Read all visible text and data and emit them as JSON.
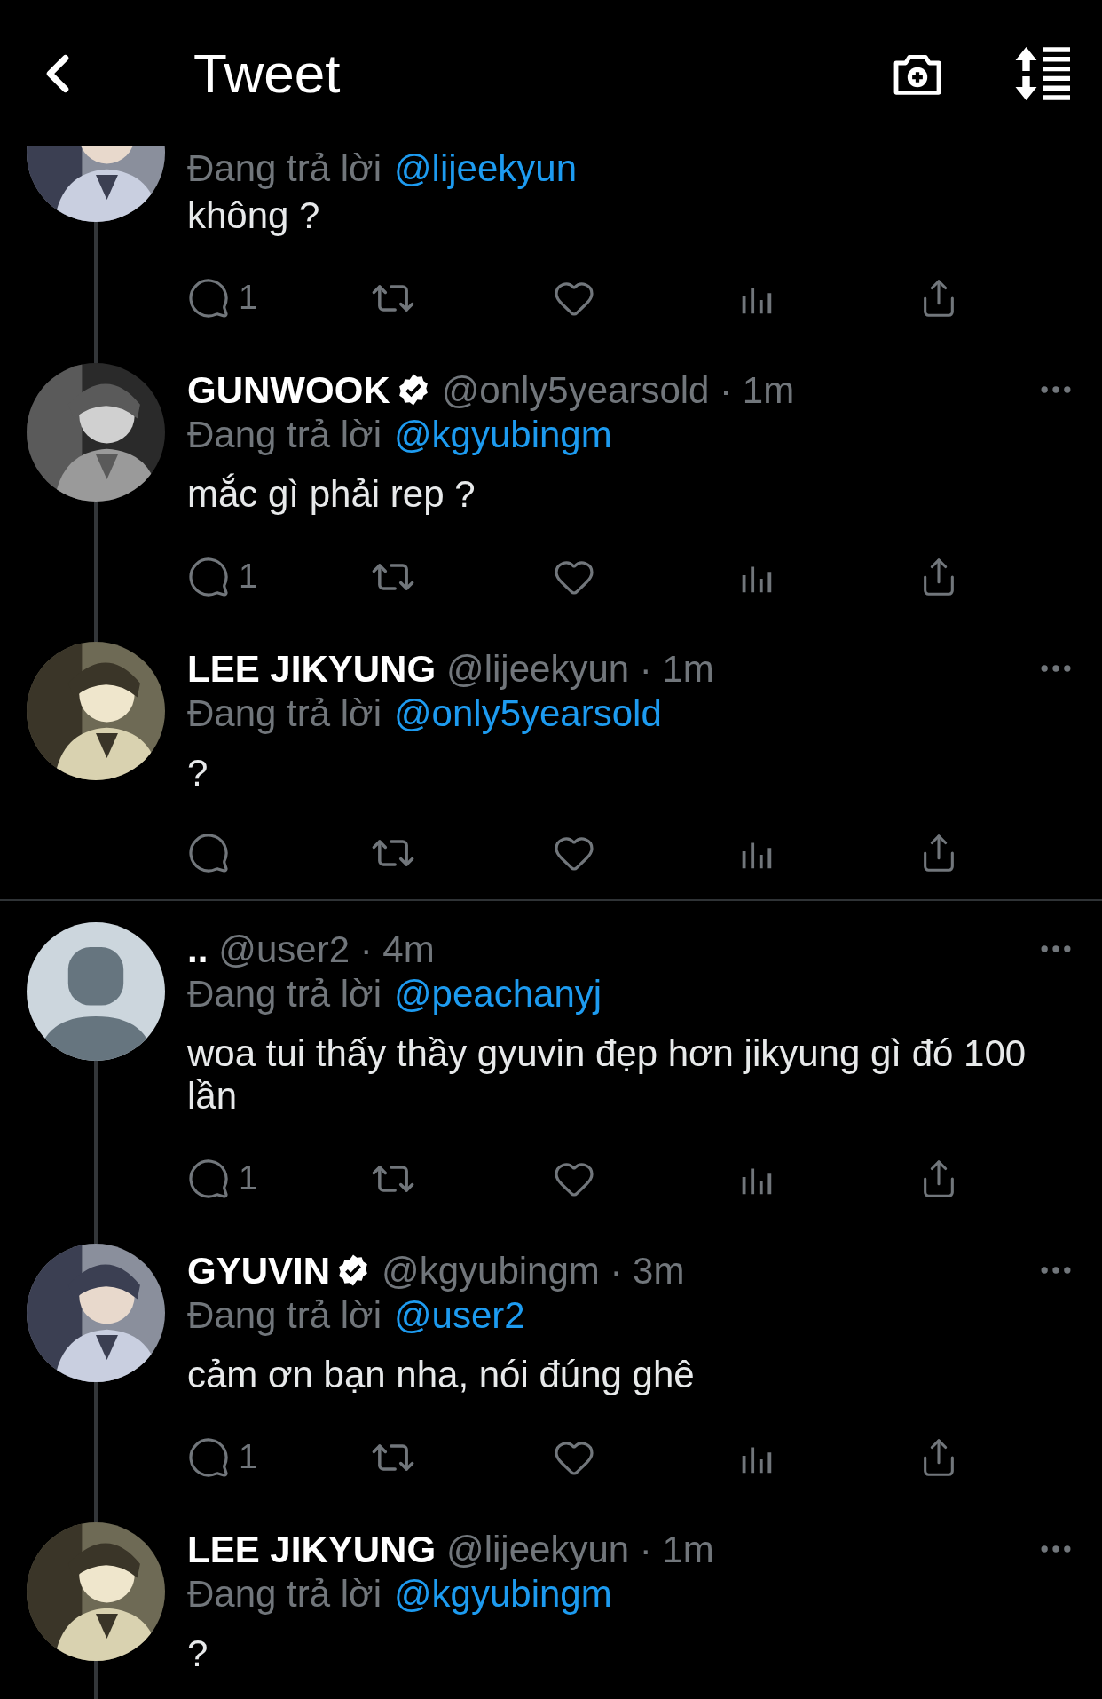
{
  "header": {
    "title": "Tweet"
  },
  "partial_tweet": {
    "reply_label": "Đang trả lời",
    "reply_to": "@lijeekyun",
    "text": "không ?",
    "reply_count": "1",
    "thread_line": true
  },
  "threads": [
    {
      "tweets": [
        {
          "name": "GUNWOOK",
          "verified": true,
          "meta": "@only5yearsold · 1m",
          "reply_label": "Đang trả lời",
          "reply_to": "@kgyubingm",
          "text": "mắc gì phải rep ?",
          "reply_count": "1",
          "show_actions": true,
          "thread_line": true
        },
        {
          "name": "LEE JIKYUNG",
          "verified": false,
          "meta": "@lijeekyun · 1m",
          "reply_label": "Đang trả lời",
          "reply_to": "@only5yearsold",
          "text": "?",
          "show_actions": true,
          "thread_line": false
        }
      ]
    },
    {
      "tweets": [
        {
          "avatar": {
            "kind": "default"
          },
          "name": "..",
          "verified": false,
          "meta": "@user2 · 4m",
          "reply_label": "Đang trả lời",
          "reply_to": "@peachanyj",
          "text": "woa tui thấy thầy gyuvin đẹp hơn jikyung gì đó 100 lần",
          "reply_count": "1",
          "show_actions": true,
          "thread_line": true
        },
        {
          "name": "GYUVIN",
          "verified": true,
          "meta": "@kgyubingm · 3m",
          "reply_label": "Đang trả lời",
          "reply_to": "@user2",
          "text": "cảm ơn bạn nha, nói đúng ghê",
          "reply_count": "1",
          "show_actions": true,
          "thread_line": true
        },
        {
          "name": "LEE JIKYUNG",
          "verified": false,
          "meta": "@lijeekyun · 1m",
          "reply_label": "Đang trả lời",
          "reply_to": "@kgyubingm",
          "text": "?",
          "show_actions": false,
          "thread_line": true
        }
      ]
    }
  ]
}
